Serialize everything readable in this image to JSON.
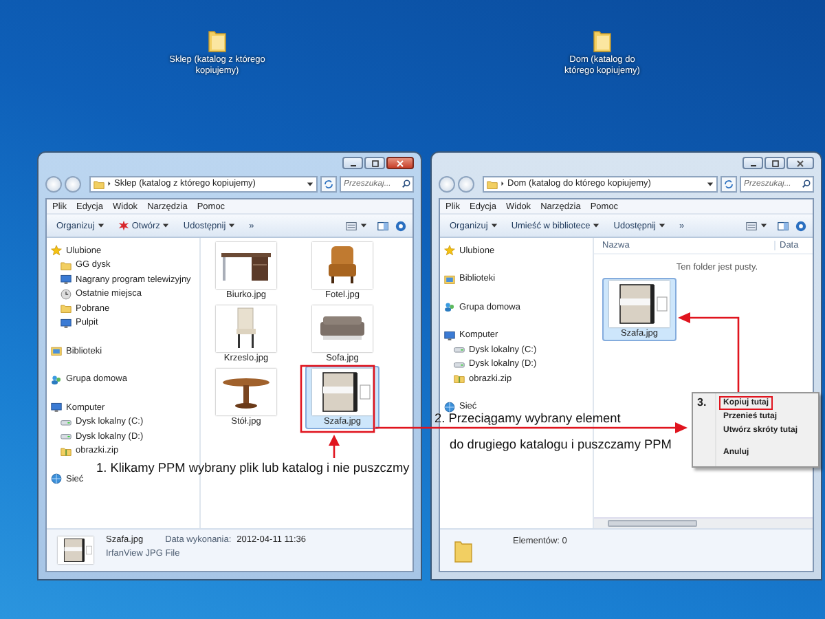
{
  "desktop_icons": [
    {
      "label": "Sklep (katalog z którego kopiujemy)"
    },
    {
      "label": "Dom (katalog do którego kopiujemy)"
    }
  ],
  "windows": [
    {
      "active": true,
      "address": "Sklep (katalog z którego kopiujemy)",
      "search": {
        "placeholder": "Przeszukaj..."
      },
      "menu": [
        "Plik",
        "Edycja",
        "Widok",
        "Narzędzia",
        "Pomoc"
      ],
      "toolbar": [
        {
          "label": "Organizuj",
          "dropdown": true,
          "icon": false
        },
        {
          "label": "Otwórz",
          "dropdown": true,
          "icon": true
        },
        {
          "label": "Udostępnij",
          "dropdown": true,
          "icon": false
        },
        {
          "label": "»",
          "dropdown": false,
          "icon": false
        }
      ],
      "sidebar": [
        {
          "label": "Ulubione",
          "children": [
            {
              "label": "GG dysk"
            },
            {
              "label": "Nagrany program telewizyjny"
            },
            {
              "label": "Ostatnie miejsca"
            },
            {
              "label": "Pobrane"
            },
            {
              "label": "Pulpit"
            }
          ]
        },
        {
          "label": "Biblioteki"
        },
        {
          "label": "Grupa domowa"
        },
        {
          "label": "Komputer",
          "children": [
            {
              "label": "Dysk lokalny (C:)"
            },
            {
              "label": "Dysk lokalny (D:)"
            },
            {
              "label": "obrazki.zip"
            }
          ]
        },
        {
          "label": "Sieć"
        }
      ],
      "files": [
        {
          "name": "Biurko.jpg",
          "selected": false
        },
        {
          "name": "Fotel.jpg",
          "selected": false
        },
        {
          "name": "Krzeslo.jpg",
          "selected": false
        },
        {
          "name": "Sofa.jpg",
          "selected": false
        },
        {
          "name": "Stół.jpg",
          "selected": false
        },
        {
          "name": "Szafa.jpg",
          "selected": true
        }
      ],
      "status": {
        "kind": "file",
        "name": "Szafa.jpg",
        "date_label": "Data wykonania:",
        "date": "2012-04-11 11:36",
        "type": "IrfanView JPG File"
      }
    },
    {
      "active": false,
      "address": "Dom (katalog do którego kopiujemy)",
      "search": {
        "placeholder": "Przeszukaj..."
      },
      "menu": [
        "Plik",
        "Edycja",
        "Widok",
        "Narzędzia",
        "Pomoc"
      ],
      "toolbar": [
        {
          "label": "Organizuj",
          "dropdown": true,
          "icon": false
        },
        {
          "label": "Umieść w bibliotece",
          "dropdown": true,
          "icon": false
        },
        {
          "label": "Udostępnij",
          "dropdown": true,
          "icon": false
        },
        {
          "label": "»",
          "dropdown": false,
          "icon": false
        }
      ],
      "sidebar": [
        {
          "label": "Ulubione"
        },
        {
          "label": "Biblioteki"
        },
        {
          "label": "Grupa domowa"
        },
        {
          "label": "Komputer",
          "children": [
            {
              "label": "Dysk lokalny (C:)"
            },
            {
              "label": "Dysk lokalny (D:)"
            },
            {
              "label": "obrazki.zip"
            }
          ]
        },
        {
          "label": "Sieć"
        }
      ],
      "columns": [
        "Nazwa",
        "Data"
      ],
      "empty_message": "Ten folder jest pusty.",
      "files": [
        {
          "name": "Szafa.jpg",
          "selected": true
        }
      ],
      "status": {
        "kind": "folder",
        "count": "Elementów: 0"
      }
    }
  ],
  "annotations": {
    "step1": "1. Klikamy PPM wybrany plik lub katalog i nie puszczmy",
    "step2": [
      "2. Przeciągamy wybrany element",
      "do drugiego katalogu i puszczamy PPM"
    ],
    "step3": "3."
  },
  "context_menu": [
    {
      "label": "Kopiuj tutaj",
      "highlighted": true
    },
    {
      "label": "Przenieś tutaj",
      "highlighted": false
    },
    {
      "label": "Utwórz skróty tutaj",
      "highlighted": false
    },
    {
      "label": "Anuluj",
      "highlighted": false
    }
  ]
}
